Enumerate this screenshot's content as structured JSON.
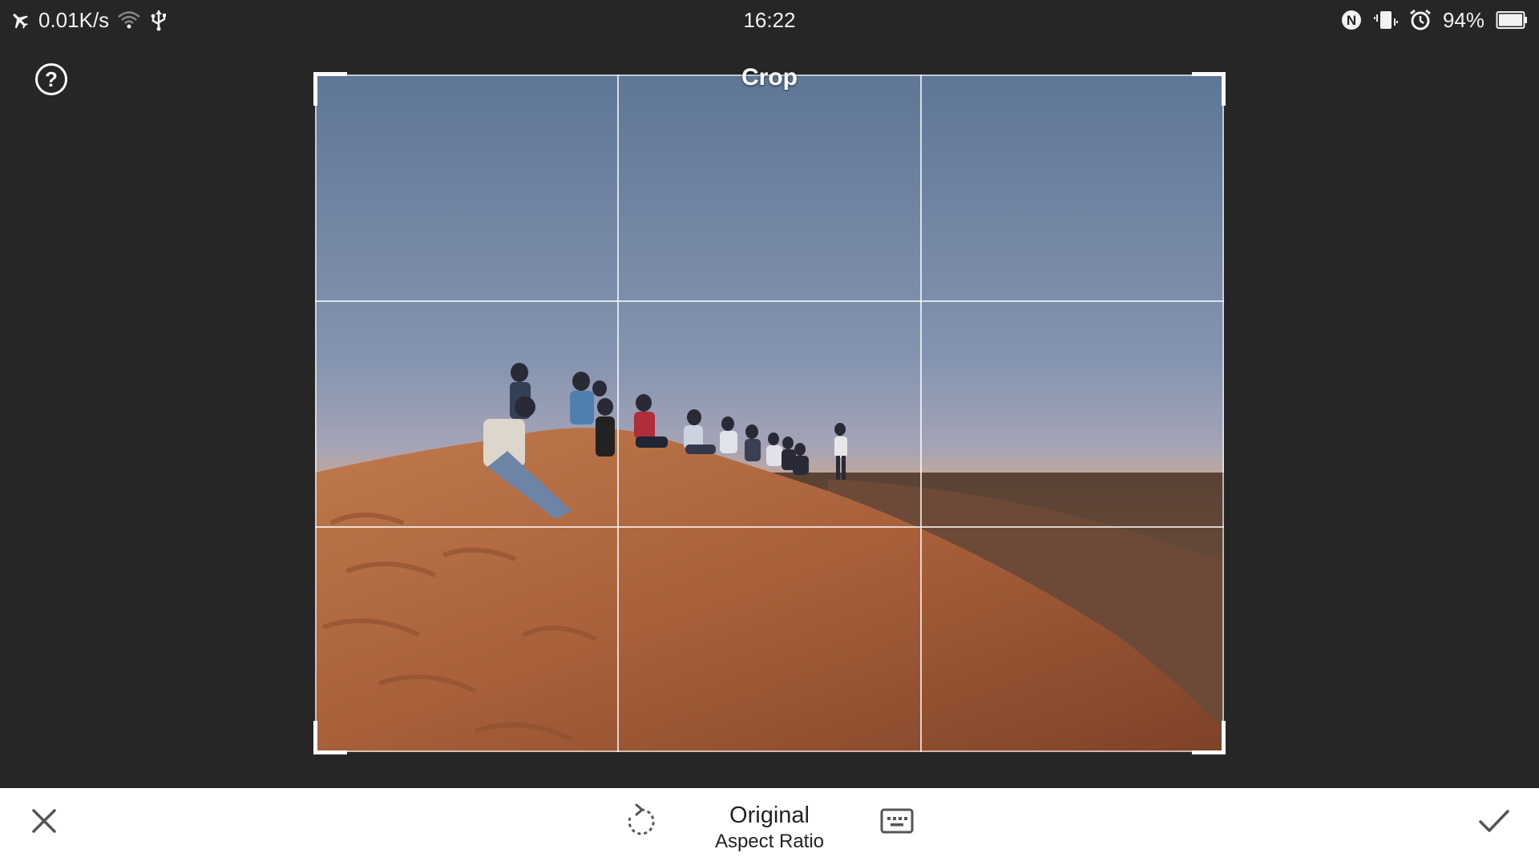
{
  "status_bar": {
    "network_speed": "0.01K/s",
    "time": "16:22",
    "battery": "94%",
    "icons": [
      "airplane-mode-icon",
      "wifi-icon",
      "usb-icon",
      "nfc-icon",
      "vibrate-icon",
      "alarm-icon",
      "battery-icon"
    ]
  },
  "editor": {
    "title": "Crop",
    "help_icon": "help-circle-icon"
  },
  "toolbar": {
    "cancel_icon": "close-icon",
    "rotate_icon": "rotate-icon",
    "aspect_ratio_value": "Original",
    "aspect_ratio_label": "Aspect Ratio",
    "aspect_icon": "keyboard-aspect-icon",
    "apply_icon": "check-icon"
  },
  "colors": {
    "background": "#262626",
    "toolbar": "#ffffff",
    "grid": "#ffffff"
  }
}
